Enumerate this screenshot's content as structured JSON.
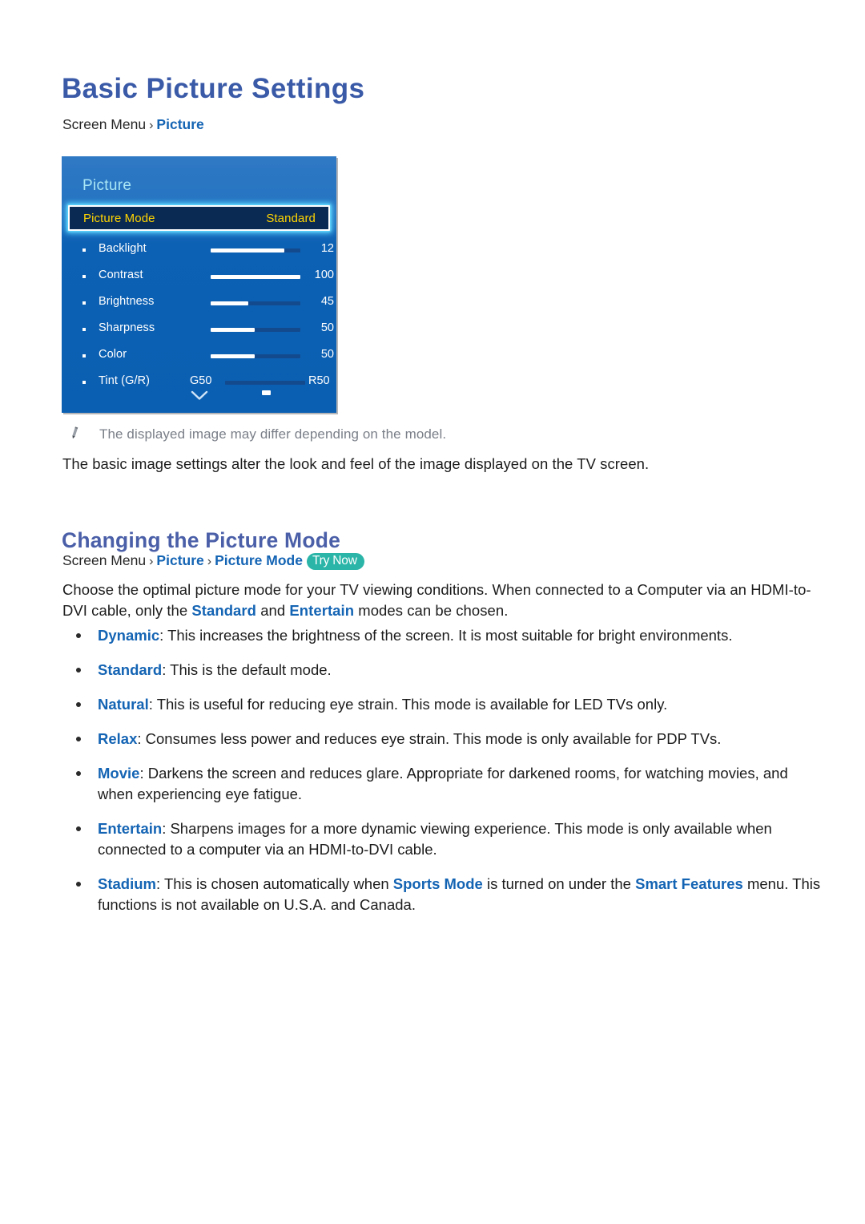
{
  "page": {
    "title": "Basic Picture Settings"
  },
  "breadcrumb_top": {
    "root": "Screen Menu",
    "separator": "›",
    "item1": "Picture"
  },
  "tv_menu": {
    "panel_title": "Picture",
    "highlight": {
      "label": "Picture Mode",
      "value": "Standard"
    },
    "rows": [
      {
        "label": "Backlight",
        "value": "12",
        "fill_pct": 82
      },
      {
        "label": "Contrast",
        "value": "100",
        "fill_pct": 100
      },
      {
        "label": "Brightness",
        "value": "45",
        "fill_pct": 42
      },
      {
        "label": "Sharpness",
        "value": "50",
        "fill_pct": 49
      },
      {
        "label": "Color",
        "value": "50",
        "fill_pct": 49
      }
    ],
    "tint_row": {
      "label": "Tint (G/R)",
      "left_value": "G50",
      "right_value": "R50"
    },
    "scroll_indicator": "chevron-down"
  },
  "note": {
    "icon": "pencil-icon",
    "text": "The displayed image may differ depending on the model."
  },
  "intro_paragraph": "The basic image settings alter the look and feel of the image displayed on the TV screen.",
  "section2": {
    "heading": "Changing the Picture Mode",
    "breadcrumb": {
      "root": "Screen Menu",
      "separator": "›",
      "item1": "Picture",
      "item2": "Picture Mode",
      "badge": "Try Now"
    },
    "paragraph_part1": "Choose the optimal picture mode for your TV viewing conditions. When connected to a Computer via an HDMI-to-DVI cable, only the ",
    "paragraph_link1": "Standard",
    "paragraph_part2": " and ",
    "paragraph_link2": "Entertain",
    "paragraph_part3": " modes can be chosen.",
    "modes": [
      {
        "name": "Dynamic",
        "colon": ": ",
        "description": "This increases the brightness of the screen. It is most suitable for bright environments."
      },
      {
        "name": "Standard",
        "colon": ": ",
        "description": "This is the default mode."
      },
      {
        "name": "Natural",
        "colon": ": ",
        "description": "This is useful for reducing eye strain. This mode is available for LED TVs only."
      },
      {
        "name": "Relax",
        "colon": ": ",
        "description": "Consumes less power and reduces eye strain. This mode is only available for PDP TVs."
      },
      {
        "name": "Movie",
        "colon": ": ",
        "description": "Darkens the screen and reduces glare. Appropriate for darkened rooms, for watching movies, and when experiencing eye fatigue."
      },
      {
        "name": "Entertain",
        "colon": ": ",
        "description": "Sharpens images for a more dynamic viewing experience. This mode is only available when connected to a computer via an HDMI-to-DVI cable."
      }
    ],
    "stadium": {
      "name": "Stadium",
      "colon": ": ",
      "part1": "This is chosen automatically when ",
      "link1": "Sports Mode",
      "part2": " is turned on under the ",
      "link2": "Smart Features",
      "part3": " menu. This functions is not available on U.S.A. and Canada."
    }
  },
  "colors": {
    "h1": "#3a5aa8",
    "h2": "#4a5fa8",
    "link_blue": "#1464b4",
    "badge_teal": "#2ab5a8",
    "tv_panel_blue": "#0b5fb2",
    "tv_highlight_bg": "#0b2a53",
    "tv_highlight_text": "#ffd400",
    "tv_title_text": "#a9e6f5",
    "note_gray": "#7a7f88"
  }
}
